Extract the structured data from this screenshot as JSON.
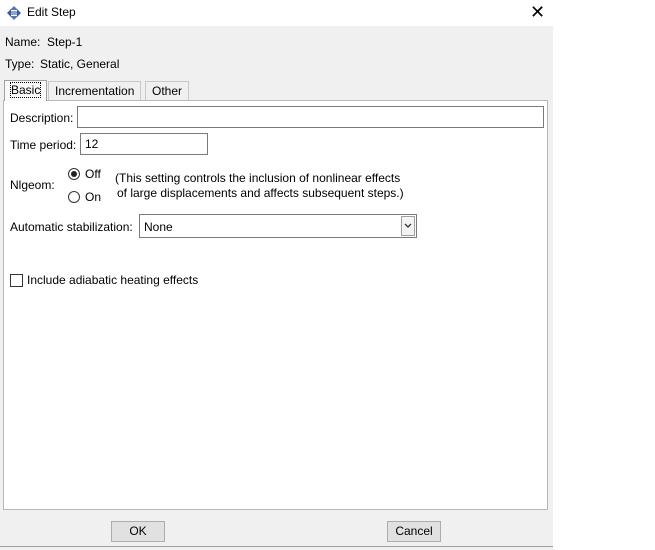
{
  "window": {
    "title": "Edit Step"
  },
  "info": {
    "name_label": "Name:",
    "name_value": "Step-1",
    "type_label": "Type:",
    "type_value": "Static, General"
  },
  "tabs": [
    {
      "label": "Basic",
      "active": true
    },
    {
      "label": "Incrementation",
      "active": false
    },
    {
      "label": "Other",
      "active": false
    }
  ],
  "basic": {
    "description_label": "Description:",
    "description_value": "",
    "time_period_label": "Time period:",
    "time_period_value": "12",
    "nlgeom_label": "Nlgeom:",
    "nlgeom_options": [
      {
        "label": "Off",
        "selected": true
      },
      {
        "label": "On",
        "selected": false
      }
    ],
    "nlgeom_note_line1": "(This setting controls the inclusion of nonlinear effects",
    "nlgeom_note_line2": "of large displacements and affects subsequent steps.)",
    "stabilization_label": "Automatic stabilization:",
    "stabilization_value": "None",
    "adiabatic_label": "Include adiabatic heating effects",
    "adiabatic_checked": false
  },
  "buttons": {
    "ok": "OK",
    "cancel": "Cancel"
  },
  "colors": {
    "window_bg": "#f0f0f0",
    "panel_bg": "#ffffff",
    "border": "#b8b8b8"
  }
}
